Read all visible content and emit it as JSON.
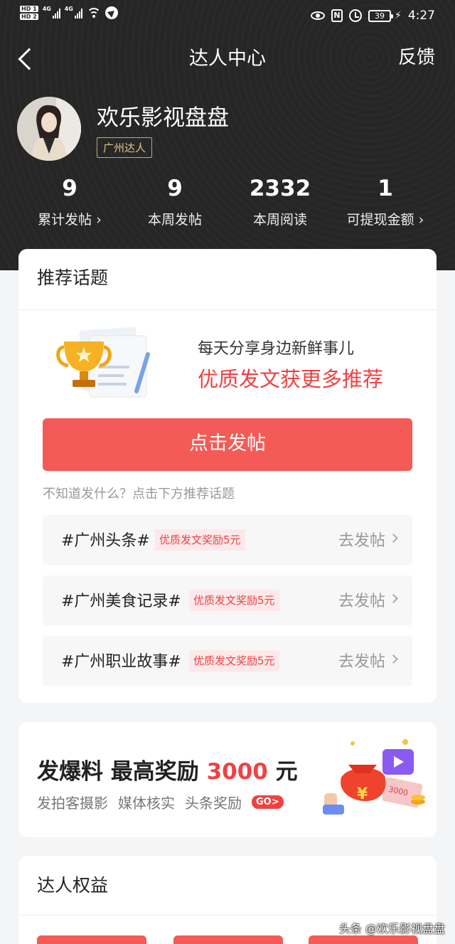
{
  "status_bar": {
    "hd1": "HD 1",
    "hd2": "HD 2",
    "net1": "4G",
    "net2": "4G",
    "nfc": "N",
    "battery": "39",
    "time": "4:27"
  },
  "header": {
    "title": "达人中心",
    "feedback": "反馈"
  },
  "profile": {
    "name": "欢乐影视盘盘",
    "badge": "广州达人"
  },
  "stats": [
    {
      "value": "9",
      "label": "累计发帖 ›"
    },
    {
      "value": "9",
      "label": "本周发帖"
    },
    {
      "value": "2332",
      "label": "本周阅读"
    },
    {
      "value": "1",
      "label": "可提现金额 ›"
    }
  ],
  "topics_card": {
    "title": "推荐话题",
    "promo_line1": "每天分享身边新鲜事儿",
    "promo_line2": "优质发文获更多推荐",
    "post_button": "点击发帖",
    "hint": "不知道发什么？点击下方推荐话题",
    "topics": [
      {
        "name": "#广州头条#",
        "reward": "优质发文奖励5元",
        "action": "去发帖"
      },
      {
        "name": "#广州美食记录#",
        "reward": "优质发文奖励5元",
        "action": "去发帖"
      },
      {
        "name": "#广州职业故事#",
        "reward": "优质发文奖励5元",
        "action": "去发帖"
      }
    ]
  },
  "scoop_card": {
    "title_prefix": "发爆料  最高奖励 ",
    "amount": "3000",
    "title_suffix": " 元",
    "sub1": "发拍客摄影",
    "sub2": "媒体核实",
    "sub3": "头条奖励",
    "go": "GO>",
    "art_yen": "¥",
    "art_bill": "3000"
  },
  "perks_card": {
    "title": "达人权益"
  },
  "watermark": "头条 @欢乐影视盘盘",
  "colors": {
    "accent_red": "#f04142",
    "button_red": "#f45b57",
    "badge_gold": "#c9a86a",
    "header_dark": "#262626"
  }
}
